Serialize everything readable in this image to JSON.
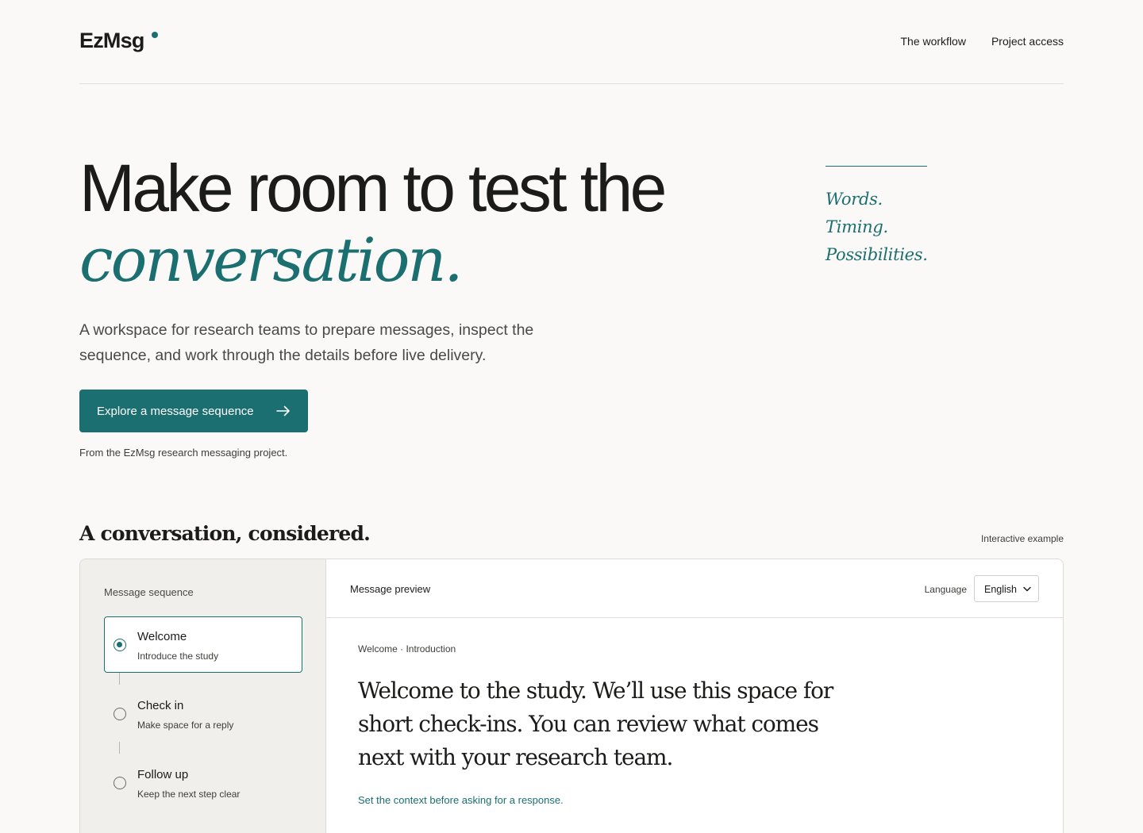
{
  "brand": {
    "name": "EzMsg",
    "accent": "#1b6f70"
  },
  "nav": {
    "items": [
      "The workflow",
      "Project access"
    ]
  },
  "hero": {
    "title_lead": "Make room to test the ",
    "title_accent": "conversation.",
    "aside": [
      "Words.",
      "Timing.",
      "Possibilities."
    ],
    "subtitle": "A workspace for research teams to prepare messages, inspect the sequence, and work through the details before live delivery.",
    "cta_label": "Explore a message sequence",
    "cta_icon": "arrow-right-icon",
    "note": "From the EzMsg research messaging project."
  },
  "section": {
    "title": "A conversation, considered.",
    "tag": "Interactive example"
  },
  "sequence": {
    "title": "Message sequence",
    "steps": [
      {
        "name": "Welcome",
        "desc": "Introduce the study",
        "selected": true
      },
      {
        "name": "Check in",
        "desc": "Make space for a reply",
        "selected": false
      },
      {
        "name": "Follow up",
        "desc": "Keep the next step clear",
        "selected": false
      }
    ]
  },
  "preview": {
    "title": "Message preview",
    "language_label": "Language",
    "language_value": "English",
    "crumb": "Welcome · Introduction",
    "message": "Welcome to the study. We’ll use this space for short check-ins. You can review what comes next with your research team.",
    "hint": "Set the context before asking for a response."
  }
}
